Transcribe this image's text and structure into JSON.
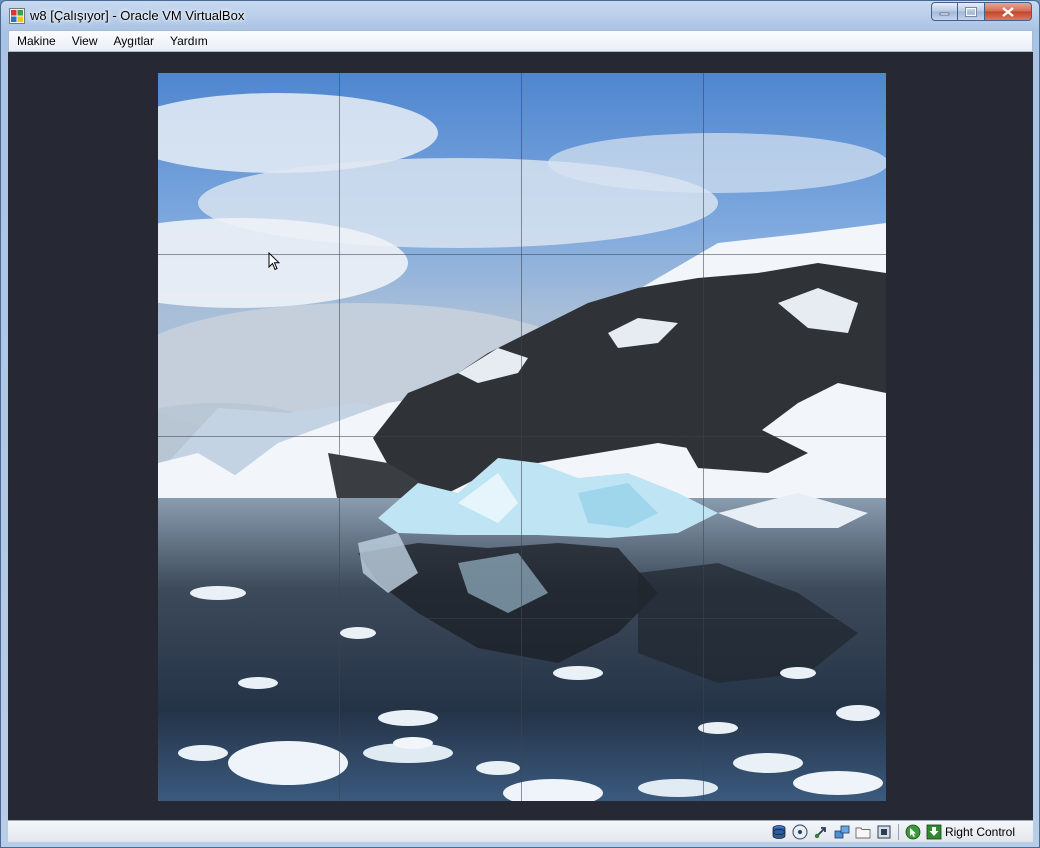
{
  "window": {
    "title": "w8 [Çalışıyor] - Oracle VM VirtualBox"
  },
  "menu": {
    "items": [
      "Makine",
      "View",
      "Aygıtlar",
      "Yardım"
    ]
  },
  "status": {
    "host_key": "Right Control"
  },
  "colors": {
    "vm_background": "#262934",
    "frame": "#a9c3e4",
    "close_button": "#c2452a"
  },
  "icons": [
    "hard-disk-icon",
    "optical-drive-icon",
    "usb-icon",
    "network-icon",
    "shared-folder-icon",
    "video-capture-icon",
    "mouse-integration-icon",
    "host-key-arrow-icon"
  ]
}
